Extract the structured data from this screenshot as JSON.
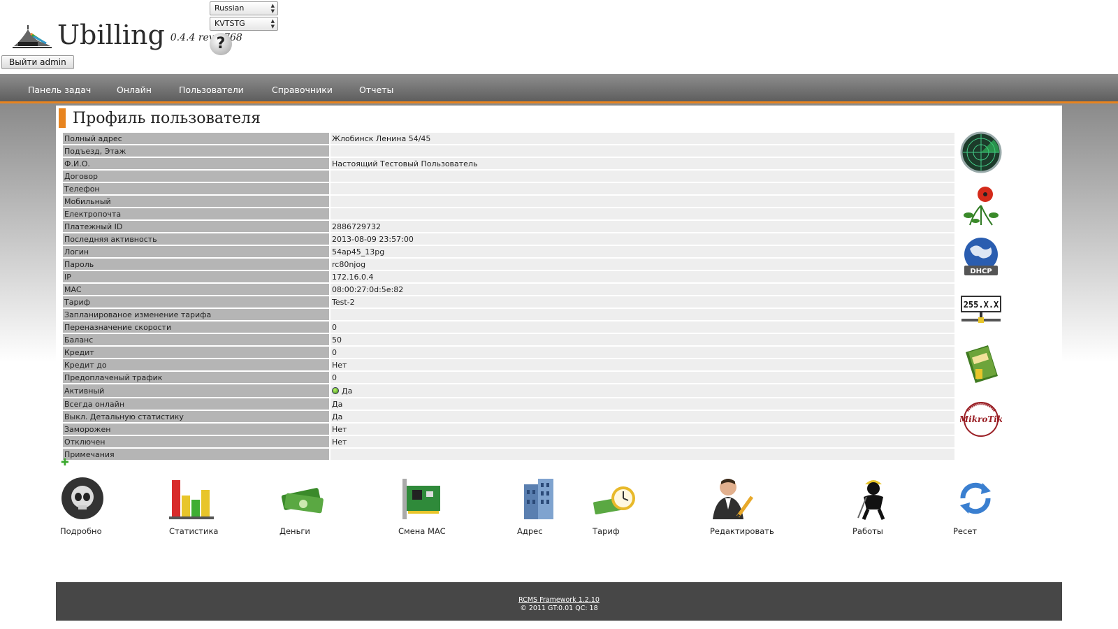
{
  "header": {
    "app_name": "Ubilling",
    "version": "0.4.4 rev 2768",
    "logout_label": "Выйти admin",
    "language_select": "Russian",
    "skin_select": "KVTSTG",
    "help_label": "?"
  },
  "nav": {
    "items": [
      "Панель задач",
      "Онлайн",
      "Пользователи",
      "Справочники",
      "Отчеты"
    ]
  },
  "page": {
    "title": "Профиль пользователя"
  },
  "profile": [
    {
      "label": "Полный адрес",
      "value": "Жлобинск Ленина 54/45"
    },
    {
      "label": "Подъезд, Этаж",
      "value": ""
    },
    {
      "label": "Ф.И.О.",
      "value": "Настоящий Тестовый Пользователь"
    },
    {
      "label": "Договор",
      "value": ""
    },
    {
      "label": "Телефон",
      "value": ""
    },
    {
      "label": "Мобильный",
      "value": ""
    },
    {
      "label": "Електропочта",
      "value": ""
    },
    {
      "label": "Платежный ID",
      "value": "2886729732"
    },
    {
      "label": "Последняя активность",
      "value": "2013-08-09 23:57:00"
    },
    {
      "label": "Логин",
      "value": "54ap45_13pg"
    },
    {
      "label": "Пароль",
      "value": "rc80njog"
    },
    {
      "label": "IP",
      "value": "172.16.0.4"
    },
    {
      "label": "MAC",
      "value": "08:00:27:0d:5e:82"
    },
    {
      "label": "Тариф",
      "value": "Test-2"
    },
    {
      "label": "Запланированое изменение тарифа",
      "value": ""
    },
    {
      "label": "Переназначение скорости",
      "value": "0"
    },
    {
      "label": "Баланс",
      "value": "50"
    },
    {
      "label": "Кредит",
      "value": "0"
    },
    {
      "label": "Кредит до",
      "value": "Нет"
    },
    {
      "label": "Предоплаченый трафик",
      "value": "0"
    },
    {
      "label": "Активный",
      "value": "Да"
    },
    {
      "label": "Всегда онлайн",
      "value": "Да"
    },
    {
      "label": "Выкл. Детальную статистику",
      "value": "Да"
    },
    {
      "label": "Заморожен",
      "value": "Нет"
    },
    {
      "label": "Отключен",
      "value": "Нет"
    },
    {
      "label": "Примечания",
      "value": ""
    }
  ],
  "side_icons": [
    "radar-icon",
    "poppy-flower-icon",
    "dhcp-globe-icon",
    "ip-255xx-icon",
    "license-book-icon",
    "mikrotik-logo-icon"
  ],
  "ip_icon_text": "255.X.X",
  "dhcp_icon_text": "DHCP",
  "mikrotik_text": "MikroTik",
  "actions": [
    {
      "label": "Подробно",
      "icon": "skull-icon"
    },
    {
      "label": "Статистика",
      "icon": "bar-chart-icon"
    },
    {
      "label": "Деньги",
      "icon": "money-icon"
    },
    {
      "label": "Смена MAC",
      "icon": "network-card-icon"
    },
    {
      "label": "Адрес",
      "icon": "building-icon"
    },
    {
      "label": "Тариф",
      "icon": "money-clock-icon"
    },
    {
      "label": "Редактировать",
      "icon": "user-edit-icon"
    },
    {
      "label": "Работы",
      "icon": "worker-icon"
    },
    {
      "label": "Ресет",
      "icon": "refresh-icon"
    }
  ],
  "footer": {
    "framework": "RCMS Framework 1.2.10",
    "stats": "© 2011 GT:0.01 QC: 18"
  },
  "colors": {
    "accent": "#e8841f",
    "nav_bg": "#6e6e6e",
    "label_bg": "#b5b5b5",
    "value_bg": "#eeeeee",
    "footer_bg": "#474747"
  }
}
